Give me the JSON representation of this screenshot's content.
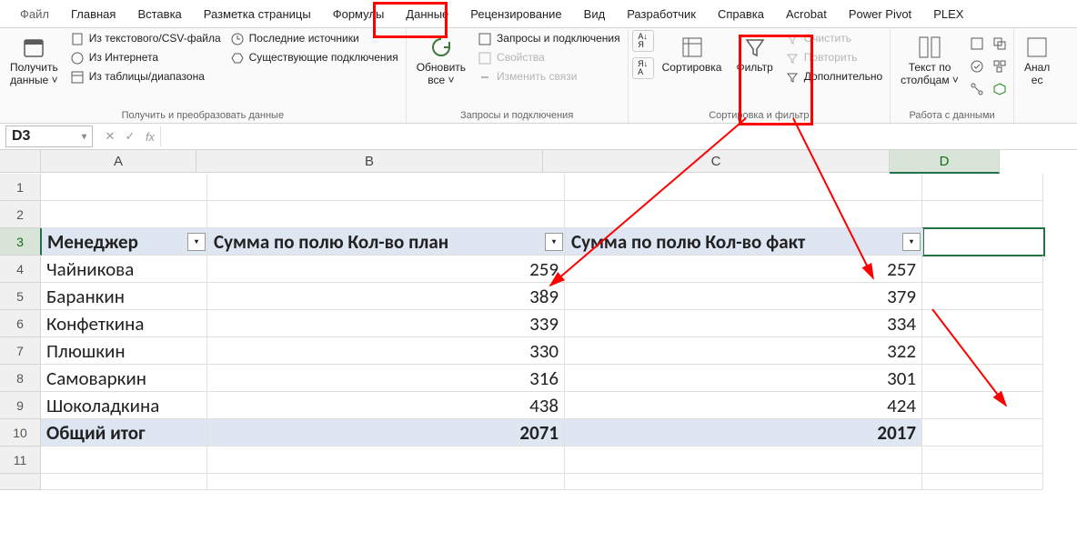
{
  "tabs": {
    "file": "Файл",
    "home": "Главная",
    "insert": "Вставка",
    "layout": "Разметка страницы",
    "formulas": "Формулы",
    "data": "Данные",
    "review": "Рецензирование",
    "view": "Вид",
    "developer": "Разработчик",
    "help": "Справка",
    "acrobat": "Acrobat",
    "powerpivot": "Power Pivot",
    "plex": "PLEX"
  },
  "ribbon": {
    "getdata": {
      "big": "Получить\nданные ˅",
      "s1": "Из текстового/CSV-файла",
      "s2": "Из Интернета",
      "s3": "Из таблицы/диапазона",
      "s4": "Последние источники",
      "s5": "Существующие подключения",
      "title": "Получить и преобразовать данные"
    },
    "refresh": {
      "big": "Обновить\nвсе ˅",
      "s1": "Запросы и подключения",
      "s2": "Свойства",
      "s3": "Изменить связи",
      "title": "Запросы и подключения"
    },
    "sort": {
      "sort": "Сортировка",
      "filter": "Фильтр",
      "clear": "Очистить",
      "reapply": "Повторить",
      "adv": "Дополнительно",
      "title": "Сортировка и фильтр"
    },
    "texttools": {
      "big": "Текст по\nстолбцам ˅",
      "title": "Работа с данными"
    },
    "analysis": {
      "big": "Анал\nес"
    }
  },
  "namebox": "D3",
  "cols": {
    "A": 170,
    "B": 380,
    "C": 380,
    "D": 120
  },
  "chart_data": {
    "type": "table",
    "headers": [
      "Менеджер",
      "Сумма по полю Кол-во план",
      "Сумма по полю Кол-во факт"
    ],
    "rows": [
      {
        "mgr": "Чайникова",
        "plan": 259,
        "fact": 257
      },
      {
        "mgr": "Баранкин",
        "plan": 389,
        "fact": 379
      },
      {
        "mgr": "Конфеткина",
        "plan": 339,
        "fact": 334
      },
      {
        "mgr": "Плюшкин",
        "plan": 330,
        "fact": 322
      },
      {
        "mgr": "Самоваркин",
        "plan": 316,
        "fact": 301
      },
      {
        "mgr": "Шоколадкина",
        "plan": 438,
        "fact": 424
      }
    ],
    "total_label": "Общий итог",
    "total_plan": 2071,
    "total_fact": 2017
  }
}
